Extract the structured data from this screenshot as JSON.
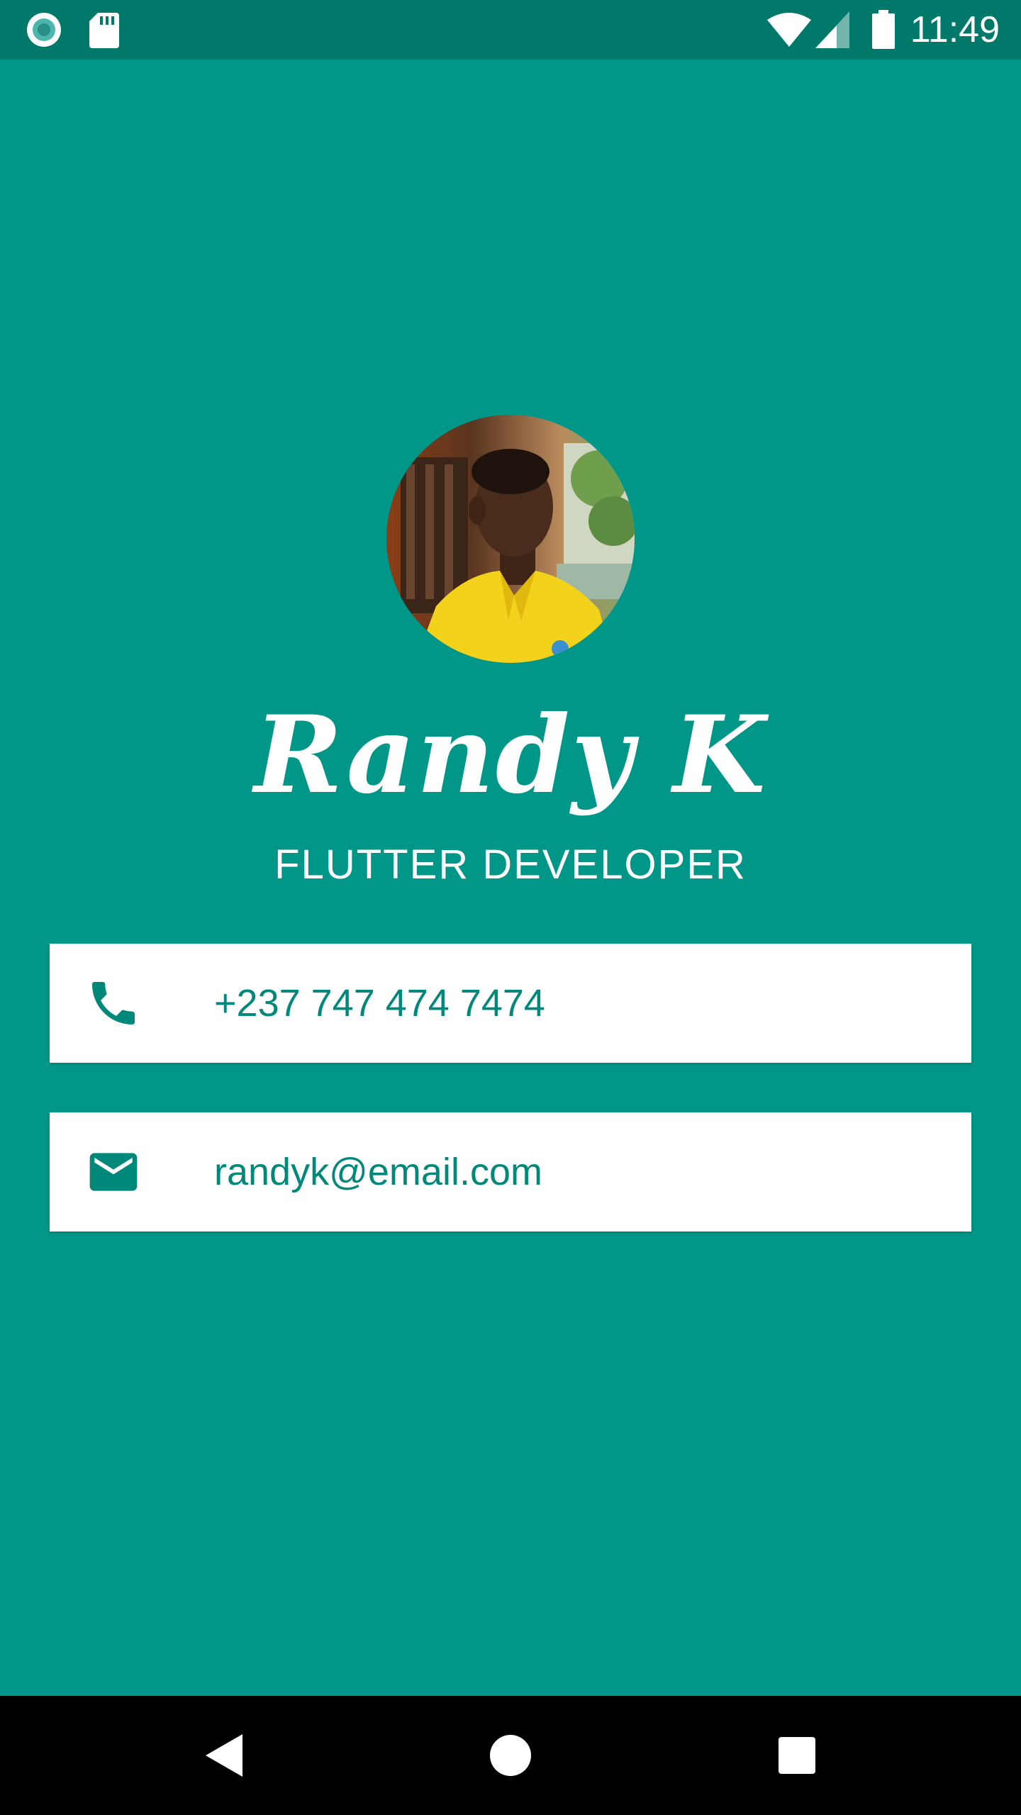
{
  "status_bar": {
    "time": "11:49",
    "icons": [
      "notification-ring-icon",
      "sd-card-icon",
      "wifi-icon",
      "cellular-signal-icon",
      "battery-icon"
    ]
  },
  "profile": {
    "avatar_alt": "profile-photo",
    "name": "Randy K",
    "title": "FLUTTER DEVELOPER"
  },
  "contacts": [
    {
      "icon": "phone-icon",
      "value": "+237 747 474 7474"
    },
    {
      "icon": "mail-icon",
      "value": "randyk@email.com"
    }
  ],
  "navigation": {
    "buttons": [
      "back-icon",
      "home-icon",
      "recents-icon"
    ]
  },
  "colors": {
    "background": "#009688",
    "status_bar": "#00796b",
    "accent_text": "#00897b",
    "card": "#ffffff",
    "nav_bar": "#000000"
  }
}
